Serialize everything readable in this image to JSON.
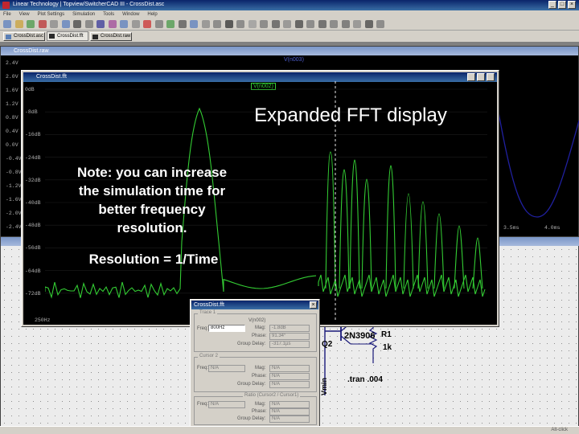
{
  "app": {
    "title": "Linear Technology | Topview/SwitcherCAD III - CrossDist.asc",
    "win_buttons": [
      "_",
      "□",
      "×"
    ]
  },
  "menu": [
    "File",
    "View",
    "Plot Settings",
    "Simulation",
    "Tools",
    "Window",
    "Help"
  ],
  "tabs": [
    {
      "label": "CrossDist.asc"
    },
    {
      "label": "CrossDist.fft"
    },
    {
      "label": "CrossDist.raw"
    }
  ],
  "colors": {
    "trace": "#33cc33",
    "cursor": "#e6e6e6",
    "time_trace": "#1a1aa0",
    "plot_bg": "#000000",
    "titlebar": "#0a246a"
  },
  "raw_window": {
    "title": "CrossDist.raw",
    "trace_label": "V(n003)",
    "y_ticks": [
      "2.4V",
      "2.0V",
      "1.6V",
      "1.2V",
      "0.8V",
      "0.4V",
      "0.0V",
      "-0.4V",
      "-0.8V",
      "-1.2V",
      "-1.6V",
      "-2.0V",
      "-2.4V"
    ],
    "x_ticks": [
      "3.5ms",
      "4.0ms"
    ]
  },
  "fft_window": {
    "title": "CrossDist.fft",
    "trace_label": "V(n002)",
    "y_ticks": [
      "0dB",
      "-8dB",
      "-16dB",
      "-24dB",
      "-32dB",
      "-40dB",
      "-48dB",
      "-56dB",
      "-64dB",
      "-72dB"
    ],
    "x_ticks": [
      "250Hz"
    ]
  },
  "annotations": {
    "title": "Expanded FFT display",
    "note": [
      "Note: you can increase",
      "the simulation time for",
      "better frequency",
      "resolution."
    ],
    "resolution": "Resolution = 1/Time"
  },
  "dialog": {
    "title": "CrossDist.fft",
    "group1": "Trace 1",
    "trace_name": "V(n002)",
    "freq_label": "Freq:",
    "freq_value": "800Hz",
    "mag_label": "Mag:",
    "mag_value": "-1.8dB",
    "phase_label": "Phase:",
    "phase_value": "91.34°",
    "group_delay_label": "Group Delay:",
    "group_delay_value": "-317.1µs",
    "group2": "Cursor 2",
    "na": "N/A",
    "ratio_label": "Ratio (Cursor2 / Cursor1)",
    "rows2": [
      "Freq:",
      "Mag:",
      "Phase:",
      "Group Delay:"
    ],
    "rows3": [
      "Freq:",
      "Mag:",
      "Phase:",
      "Group Delay:"
    ]
  },
  "schematic": {
    "q_part": "2N3906",
    "q_ref": "Q2",
    "r_ref": "R1",
    "r_val": "1k",
    "directive": ".tran .004",
    "source": "Vmin"
  },
  "statusbar": {
    "text": "Alt-click"
  }
}
